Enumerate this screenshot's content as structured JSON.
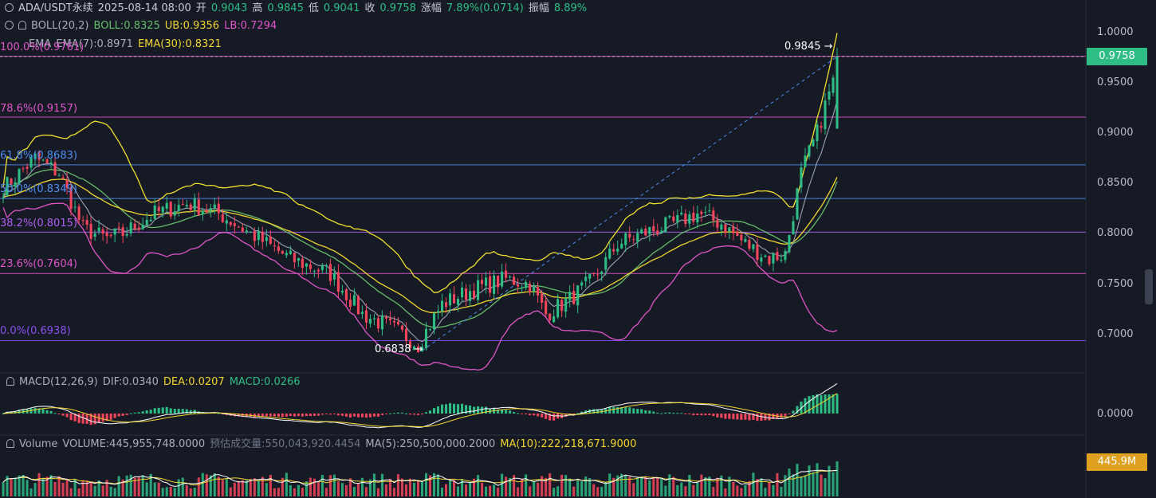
{
  "header": {
    "symbol": "ADA/USDT永续",
    "datetime": "2025-08-14 08:00",
    "open_label": "开",
    "open": "0.9043",
    "high_label": "高",
    "high": "0.9845",
    "low_label": "低",
    "low": "0.9041",
    "close_label": "收",
    "close": "0.9758",
    "change_label": "涨幅",
    "change": "7.89%(0.0714)",
    "amp_label": "振幅",
    "amp": "8.89%"
  },
  "boll": {
    "label": "BOLL(20,2)",
    "mid": "BOLL:0.8325",
    "ub": "UB:0.9356",
    "lb": "LB:0.7294"
  },
  "ema": {
    "label": "EMA",
    "ema7": "EMA(7):0.8971",
    "ema30": "EMA(30):0.8321"
  },
  "fib": [
    {
      "label": "100.0%(0.9761)",
      "value": 0.9761,
      "color": "#e055c8"
    },
    {
      "label": "78.6%(0.9157)",
      "value": 0.9157,
      "color": "#e055c8"
    },
    {
      "label": "61.8%(0.8683)",
      "value": 0.8683,
      "color": "#4e8cf0"
    },
    {
      "label": "50.0%(0.8349)",
      "value": 0.8349,
      "color": "#4e8cf0"
    },
    {
      "label": "38.2%(0.8015)",
      "value": 0.8015,
      "color": "#b05ef0"
    },
    {
      "label": "23.6%(0.7604)",
      "value": 0.7604,
      "color": "#e055c8"
    },
    {
      "label": "0.0%(0.6938)",
      "value": 0.6938,
      "color": "#8a4ef0"
    }
  ],
  "annotations": {
    "high": "0.9845 →",
    "low": "0.6838 →"
  },
  "price_axis": [
    "1.0000",
    "0.9500",
    "0.9000",
    "0.8500",
    "0.8000",
    "0.7500",
    "0.7000"
  ],
  "price_tag": "0.9758",
  "macd": {
    "label": "MACD(12,26,9)",
    "dif": "DIF:0.0340",
    "dea": "DEA:0.0207",
    "macd": "MACD:0.0266",
    "axis": "0.0000"
  },
  "volume": {
    "label": "Volume",
    "vol": "VOLUME:445,955,748.0000",
    "est": "预估成交量:550,043,920.4454",
    "ma5": "MA(5):250,500,000.2000",
    "ma10": "MA(10):222,218,671.9000",
    "tag": "445.9M"
  },
  "colors": {
    "up": "#2ebd85",
    "down": "#f6465d",
    "bg": "#161a25"
  },
  "chart_data": {
    "type": "candlestick",
    "ylim": [
      0.68,
      1.005
    ],
    "anchors": [
      [
        0,
        0.845
      ],
      [
        8,
        0.875
      ],
      [
        14,
        0.86
      ],
      [
        20,
        0.805
      ],
      [
        26,
        0.795
      ],
      [
        30,
        0.8
      ],
      [
        38,
        0.82
      ],
      [
        46,
        0.83
      ],
      [
        54,
        0.82
      ],
      [
        62,
        0.8
      ],
      [
        72,
        0.775
      ],
      [
        82,
        0.76
      ],
      [
        90,
        0.72
      ],
      [
        98,
        0.705
      ],
      [
        104,
        0.69
      ],
      [
        110,
        0.73
      ],
      [
        118,
        0.745
      ],
      [
        126,
        0.755
      ],
      [
        132,
        0.75
      ],
      [
        136,
        0.72
      ],
      [
        142,
        0.735
      ],
      [
        148,
        0.755
      ],
      [
        154,
        0.79
      ],
      [
        160,
        0.8
      ],
      [
        168,
        0.81
      ],
      [
        174,
        0.82
      ],
      [
        180,
        0.81
      ],
      [
        186,
        0.79
      ],
      [
        192,
        0.775
      ],
      [
        196,
        0.78
      ],
      [
        200,
        0.86
      ],
      [
        204,
        0.9
      ],
      [
        208,
        0.955
      ],
      [
        209,
        0.9758
      ]
    ],
    "high_point": {
      "index": 209,
      "value": 0.9845
    },
    "low_point": {
      "index": 105,
      "value": 0.6838
    },
    "n_candles": 210
  }
}
